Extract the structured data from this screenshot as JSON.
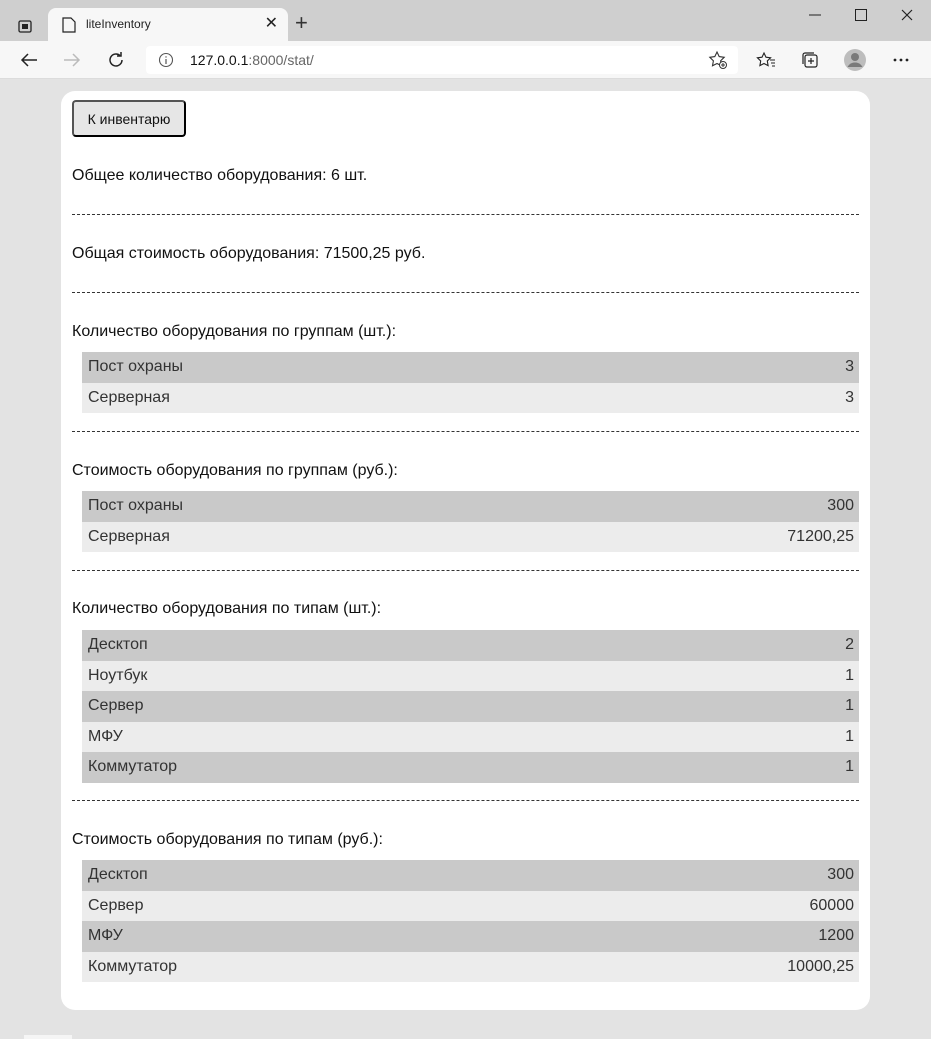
{
  "browser": {
    "tab_title": "liteInventory",
    "address_host": "127.0.0.1",
    "address_rest": ":8000/stat/"
  },
  "page": {
    "back_button": "К инвентарю",
    "total_count": "Общее количество оборудования: 6 шт.",
    "total_cost": "Общая стоимость оборудования: 71500,25 руб.",
    "sections": [
      {
        "title": "Количество оборудования по группам (шт.):",
        "rows": [
          {
            "name": "Пост охраны",
            "value": "3"
          },
          {
            "name": "Серверная",
            "value": "3"
          }
        ]
      },
      {
        "title": "Стоимость оборудования по группам (руб.):",
        "rows": [
          {
            "name": "Пост охраны",
            "value": "300"
          },
          {
            "name": "Серверная",
            "value": "71200,25"
          }
        ]
      },
      {
        "title": "Количество оборудования по типам (шт.):",
        "rows": [
          {
            "name": "Десктоп",
            "value": "2"
          },
          {
            "name": "Ноутбук",
            "value": "1"
          },
          {
            "name": "Сервер",
            "value": "1"
          },
          {
            "name": "МФУ",
            "value": "1"
          },
          {
            "name": "Коммутатор",
            "value": "1"
          }
        ]
      },
      {
        "title": "Стоимость оборудования по типам (руб.):",
        "rows": [
          {
            "name": "Десктоп",
            "value": "300"
          },
          {
            "name": "Сервер",
            "value": "60000"
          },
          {
            "name": "МФУ",
            "value": "1200"
          },
          {
            "name": "Коммутатор",
            "value": "10000,25"
          }
        ]
      }
    ]
  }
}
